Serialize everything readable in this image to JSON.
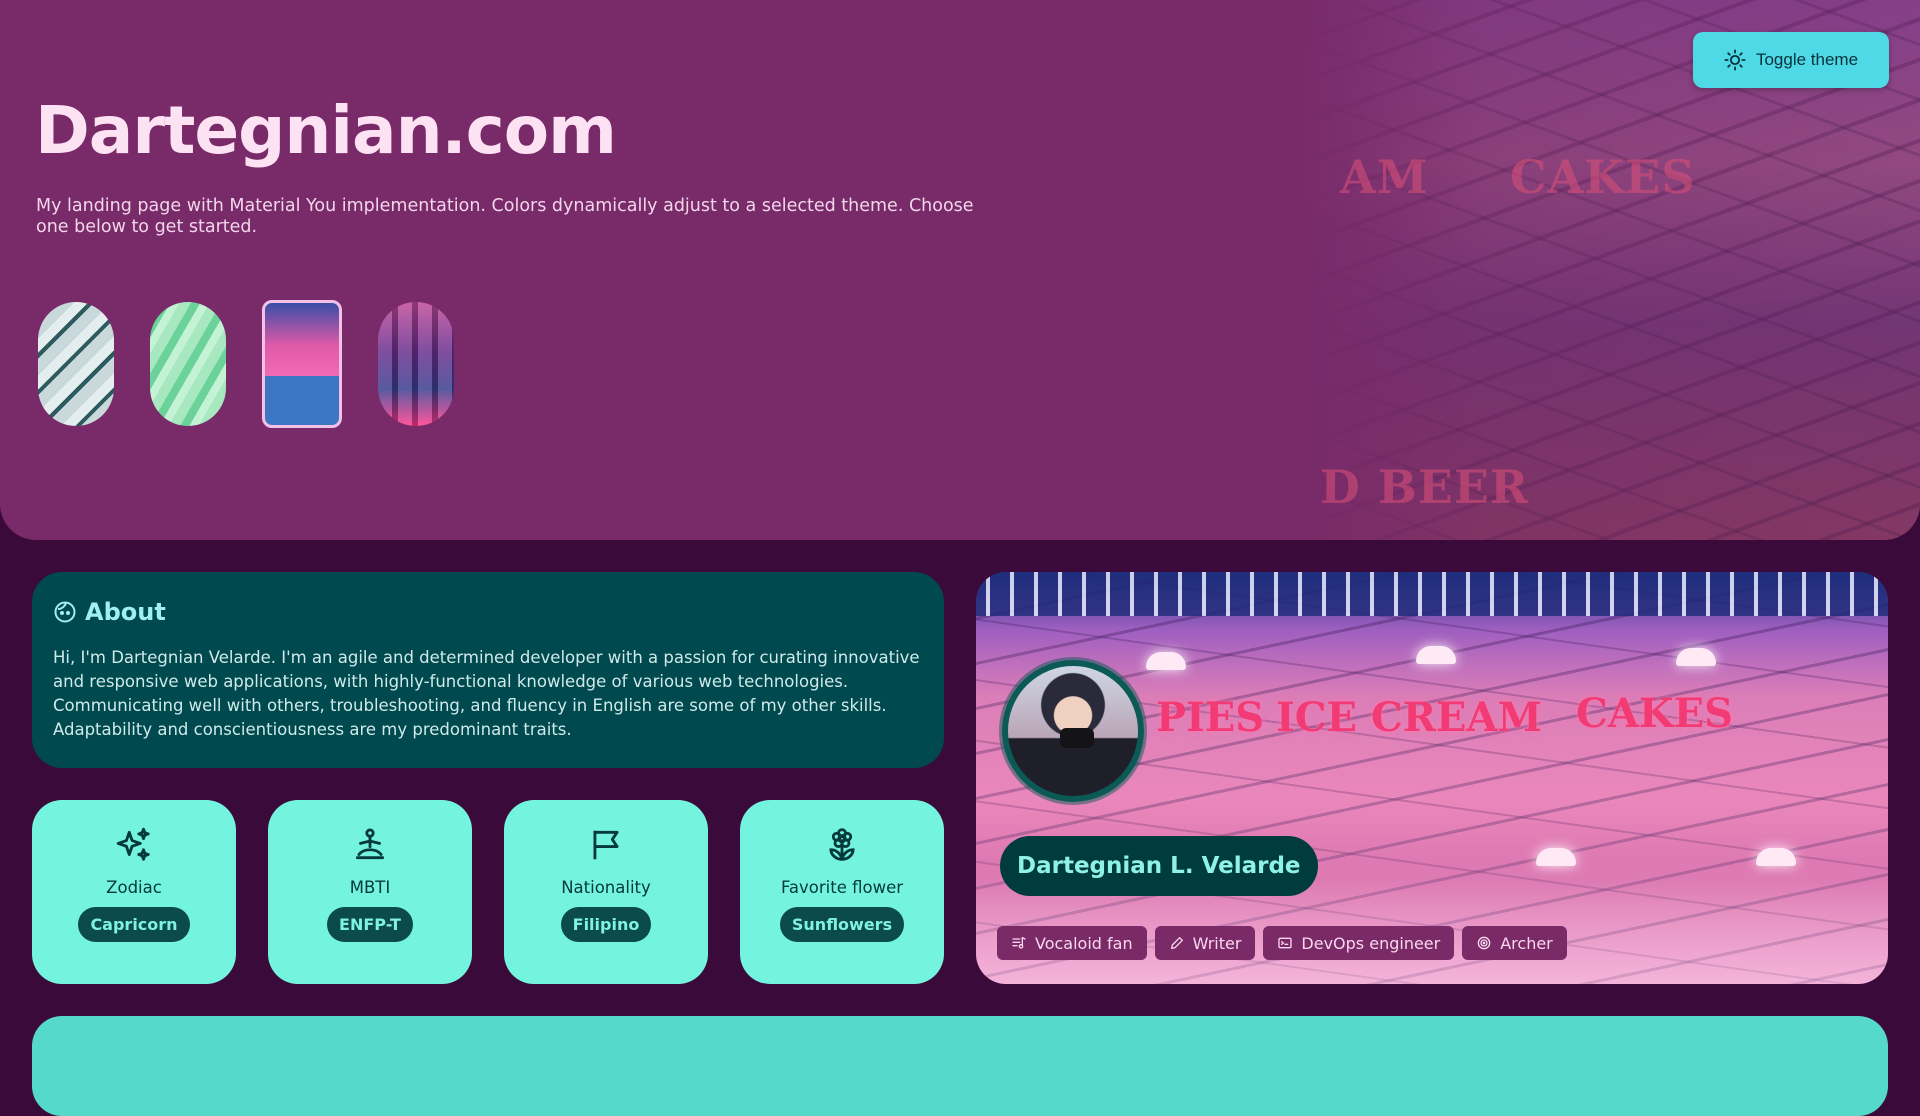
{
  "header": {
    "toggle_label": "Toggle theme",
    "title": "Dartegnian.com",
    "subtitle": "My landing page with Material You implementation. Colors dynamically adjust to a selected theme. Choose one below to get started.",
    "themes": [
      {
        "name": "theme-glass-stairs",
        "selected": false
      },
      {
        "name": "theme-green-waves",
        "selected": false
      },
      {
        "name": "theme-neon-shop",
        "selected": true
      },
      {
        "name": "theme-arcade",
        "selected": false
      }
    ],
    "photo_signs": [
      "AM",
      "CAKES",
      "D BEER"
    ]
  },
  "about": {
    "icon": "face-icon",
    "title": "About",
    "text": "Hi, I'm Dartegnian Velarde. I'm an agile and determined developer with a passion for curating innovative and responsive web applications, with highly-functional knowledge of various web technologies. Communicating well with others, troubleshooting, and fluency in English are some of my other skills. Adaptability and conscientiousness are my predominant traits."
  },
  "traits": [
    {
      "icon": "sparkles-icon",
      "label": "Zodiac",
      "value": "Capricorn"
    },
    {
      "icon": "meditation-icon",
      "label": "MBTI",
      "value": "ENFP-T"
    },
    {
      "icon": "flag-icon",
      "label": "Nationality",
      "value": "Filipino"
    },
    {
      "icon": "flower-icon",
      "label": "Favorite flower",
      "value": "Sunflowers"
    }
  ],
  "profile": {
    "name": "Dartegnian L. Velarde",
    "signs": [
      "PIES",
      "ICE CREAM",
      "CAKES"
    ],
    "tags": [
      {
        "icon": "music-note-icon",
        "label": "Vocaloid fan"
      },
      {
        "icon": "pencil-icon",
        "label": "Writer"
      },
      {
        "icon": "terminal-icon",
        "label": "DevOps engineer"
      },
      {
        "icon": "target-icon",
        "label": "Archer"
      }
    ]
  },
  "colors": {
    "hero_bg": "#782a69",
    "page_bg": "#3a0b3a",
    "about_bg": "#00494f",
    "trait_bg": "#74f4de",
    "accent": "#4fd8e6"
  }
}
